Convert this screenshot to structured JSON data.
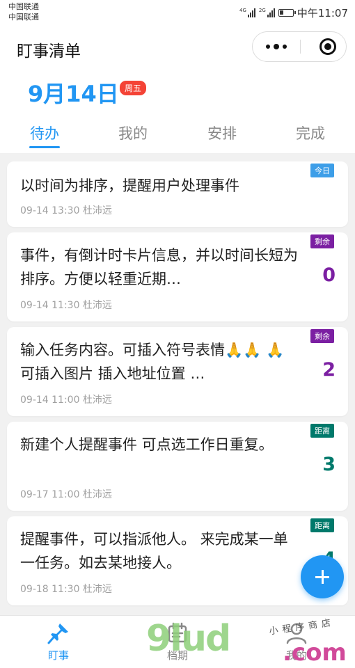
{
  "status_bar": {
    "carrier_1": "中国联通",
    "carrier_2": "中国联通",
    "network_1": "4G",
    "network_2": "2G",
    "time": "中午11:07"
  },
  "nav": {
    "title": "盯事清单"
  },
  "header": {
    "date": "9月14日",
    "weekday": "周五",
    "tabs": [
      {
        "label": "待办",
        "active": true
      },
      {
        "label": "我的",
        "active": false
      },
      {
        "label": "安排",
        "active": false
      },
      {
        "label": "完成",
        "active": false
      }
    ]
  },
  "tasks": [
    {
      "title": "以时间为排序，提醒用户处理事件",
      "meta": "09-14 13:30 杜沛远",
      "badge": "今日",
      "badge_color": "#3d9ee8",
      "count": "",
      "count_color": ""
    },
    {
      "title": "事件，有倒计时卡片信息，并以时间长短为排序。方便以轻重近期…",
      "meta": "09-14 11:30 杜沛远",
      "badge": "剩余",
      "badge_color": "#7b1fa2",
      "count": "0",
      "count_color": "#7b1fa2"
    },
    {
      "title": "输入任务内容。可插入符号表情🙏🙏 🙏 可插入图片 插入地址位置 …",
      "meta": "09-14 11:00 杜沛远",
      "badge": "剩余",
      "badge_color": "#7b1fa2",
      "count": "2",
      "count_color": "#7b1fa2"
    },
    {
      "title": "新建个人提醒事件 可点选工作日重复。",
      "meta": "09-17 11:00 杜沛远",
      "badge": "距离",
      "badge_color": "#00796b",
      "count": "3",
      "count_color": "#00796b"
    },
    {
      "title": "提醒事件，可以指派他人。 来完成某一单一任务。如去某地接人。",
      "meta": "09-18 11:30 杜沛远",
      "badge": "距离",
      "badge_color": "#00796b",
      "count": "4",
      "count_color": "#00796b"
    }
  ],
  "bottom_tabs": [
    {
      "label": "盯事",
      "icon": "pin-icon",
      "active": true
    },
    {
      "label": "档期",
      "icon": "calendar-icon",
      "active": false
    },
    {
      "label": "我的",
      "icon": "person-icon",
      "active": false
    }
  ],
  "watermark": {
    "logo": "9lud",
    "domain": ".com",
    "shop": "小程序商店"
  },
  "colors": {
    "accent": "#2196f3",
    "weekday_badge": "#f44336"
  }
}
